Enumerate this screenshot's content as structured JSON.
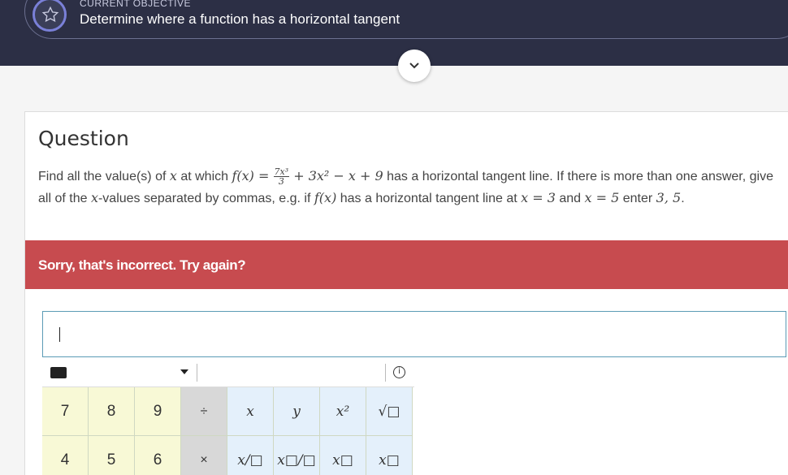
{
  "header": {
    "objective_label": "CURRENT OBJECTIVE",
    "objective_title": "Determine where a function has a horizontal tangent",
    "star_icon": "star-icon",
    "expand_icon": "chevron-down-icon"
  },
  "question": {
    "heading": "Question",
    "text_part1": "Find all the value(s) of ",
    "var_x": "x",
    "text_part2": " at which ",
    "f_of_x": "f(x)",
    "equals": " = ",
    "frac_num": "7x³",
    "frac_den": "3",
    "poly_rest": " + 3x² − x + 9",
    "text_part3": " has a horizontal tangent line. If there is more than one answer, give all of the ",
    "text_part4": "-values separated by commas, e.g. if ",
    "text_part5": " has a horizontal tangent line at ",
    "x_eq_3": "x = 3",
    "and": " and ",
    "x_eq_5": "x = 5",
    "enter": " enter ",
    "example": "3, 5",
    "period": "."
  },
  "feedback": {
    "message": "Sorry, that's incorrect. Try again?",
    "color": "#c74b4f"
  },
  "answer": {
    "value": ""
  },
  "keyboard": {
    "keyboard_icon": "keyboard-icon",
    "info_icon_label": "i",
    "row1": [
      "7",
      "8",
      "9",
      "÷",
      "x",
      "y",
      "x²",
      "√□"
    ],
    "row2": [
      "4",
      "5",
      "6",
      "×",
      "x/□",
      "x□/□",
      "x□",
      "x□"
    ]
  }
}
